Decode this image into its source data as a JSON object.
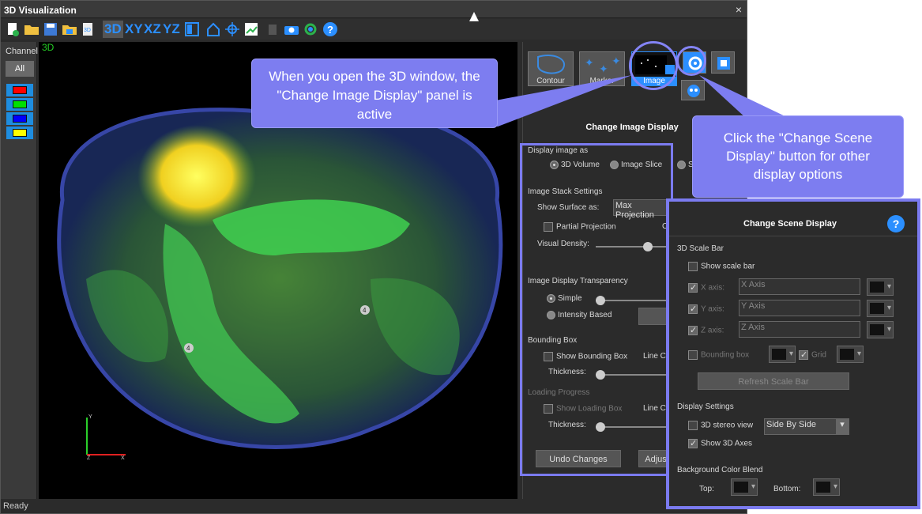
{
  "window": {
    "title": "3D Visualization",
    "close": "×"
  },
  "toolbar": {
    "view_3d": "3D",
    "view_xy": "XY",
    "view_xz": "XZ",
    "view_yz": "YZ",
    "help": "?"
  },
  "channel": {
    "label": "Channel",
    "all": "All",
    "colors": [
      "#ff0000",
      "#00e000",
      "#0000ff",
      "#ffff00"
    ]
  },
  "viewport": {
    "tag": "3D",
    "markers": [
      "4",
      "4"
    ],
    "axes": {
      "y": "Y",
      "z": "Z",
      "x": "X"
    }
  },
  "status": "Ready",
  "panel": {
    "buttons": {
      "contour": "Contour",
      "marker": "Marker",
      "image": "Image"
    },
    "title": "Change Image Display",
    "display_as": {
      "label": "Display image as",
      "volume": "3D Volume",
      "slice": "Image Slice",
      "third": "S"
    },
    "stack": {
      "label": "Image Stack Settings",
      "surface_label": "Show Surface as:",
      "surface_value": "Max Projection",
      "partial": "Partial Projection",
      "partial_suffix": "C",
      "density": "Visual Density:"
    },
    "transparency": {
      "label": "Image Display Transparency",
      "simple": "Simple",
      "intensity": "Intensity Based"
    },
    "bbox": {
      "label": "Bounding Box",
      "show": "Show Bounding Box",
      "line": "Line Co",
      "thickness": "Thickness:"
    },
    "loading": {
      "label": "Loading Progress",
      "show": "Show Loading Box",
      "line": "Line Co",
      "thickness": "Thickness:"
    },
    "undo": "Undo Changes",
    "adjust": "Adjus"
  },
  "scene": {
    "title": "Change Scene Display",
    "help": "?",
    "scale_bar": {
      "label": "3D Scale Bar",
      "show": "Show scale bar",
      "x_label": "X axis:",
      "x_value": "X Axis",
      "y_label": "Y axis:",
      "y_value": "Y Axis",
      "z_label": "Z axis:",
      "z_value": "Z Axis",
      "bbox": "Bounding box",
      "grid": "Grid",
      "refresh": "Refresh Scale Bar"
    },
    "display": {
      "label": "Display Settings",
      "stereo": "3D stereo view",
      "stereo_value": "Side By Side",
      "axes": "Show 3D Axes"
    },
    "bg": {
      "label": "Background Color Blend",
      "top": "Top:",
      "bottom": "Bottom:"
    }
  },
  "callouts": {
    "left": "When you open the 3D window, the \"Change Image Display\" panel is active",
    "right": "Click the \"Change Scene Display\" button for other display options"
  }
}
